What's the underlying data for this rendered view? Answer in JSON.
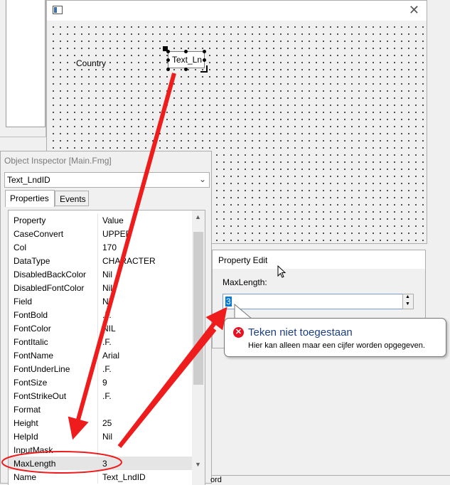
{
  "designer": {
    "close_glyph": "✕",
    "label_text": "Country",
    "textbox_text": "Text_Ln"
  },
  "inspector": {
    "title": "Object Inspector [Main.Fmg]",
    "selected_object": "Text_LndID",
    "tabs": [
      "Properties",
      "Events"
    ],
    "columns": [
      "Property",
      "Value"
    ],
    "rows": [
      {
        "property": "CaseConvert",
        "value": "UPPER"
      },
      {
        "property": "Col",
        "value": "170"
      },
      {
        "property": "DataType",
        "value": "CHARACTER"
      },
      {
        "property": "DisabledBackColor",
        "value": "Nil"
      },
      {
        "property": "DisabledFontColor",
        "value": "Nil"
      },
      {
        "property": "Field",
        "value": "Nil"
      },
      {
        "property": "FontBold",
        "value": ".F."
      },
      {
        "property": "FontColor",
        "value": "NIL"
      },
      {
        "property": "FontItalic",
        "value": ".F."
      },
      {
        "property": "FontName",
        "value": "Arial"
      },
      {
        "property": "FontUnderLine",
        "value": ".F."
      },
      {
        "property": "FontSize",
        "value": "9"
      },
      {
        "property": "FontStrikeOut",
        "value": ".F."
      },
      {
        "property": "Format",
        "value": ""
      },
      {
        "property": "Height",
        "value": "25"
      },
      {
        "property": "HelpId",
        "value": "Nil"
      },
      {
        "property": "InputMask",
        "value": ""
      },
      {
        "property": "MaxLength",
        "value": "3"
      },
      {
        "property": "Name",
        "value": "Text_LndID"
      }
    ]
  },
  "property_edit": {
    "title": "Property Edit",
    "field_label": "MaxLength:",
    "field_value": "3"
  },
  "balloon": {
    "title": "Teken niet toegestaan",
    "message": "Hier kan alleen maar een cijfer worden opgegeven."
  },
  "bottom_strip_text": "ord",
  "colors": {
    "annotation": "#ee1c1c",
    "selection": "#0078d7",
    "error_icon": "#e81123",
    "balloon_title": "#1e3f7f"
  }
}
